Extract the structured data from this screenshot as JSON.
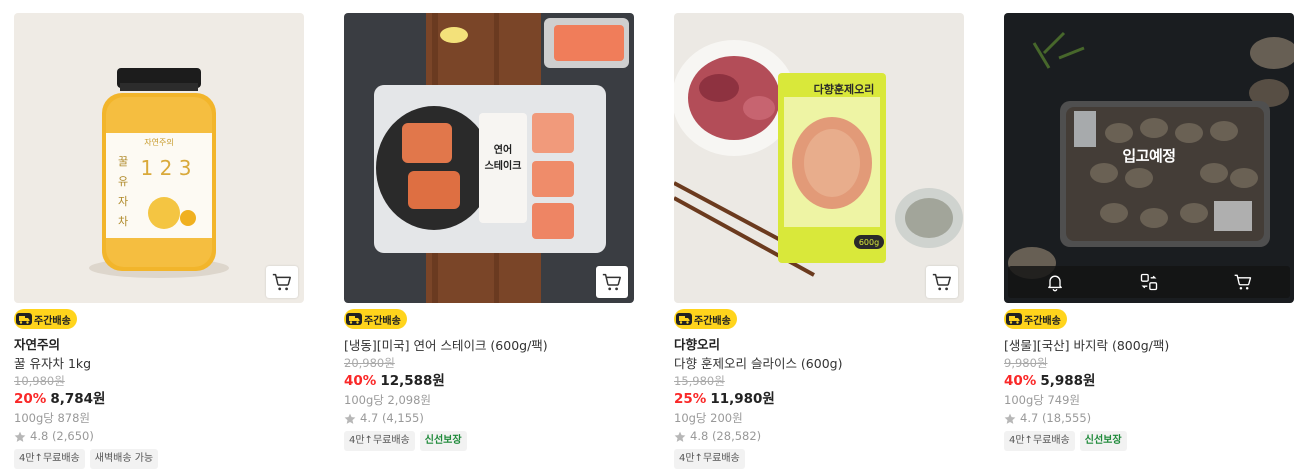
{
  "colors": {
    "badge": "#ffd41c",
    "discount": "#fa2828",
    "fresh_tag": "#1f8a3a",
    "overlay_bar": "#141414"
  },
  "products": [
    {
      "badge": "주간배송",
      "brand": "자연주의",
      "name": "꿀 유자차 1kg",
      "original_price": "10,980원",
      "discount": "20%",
      "price": "8,784원",
      "unit_price": "100g당 878원",
      "rating": "4.8 (2,650)",
      "tags": [
        "4만↑무료배송",
        "새벽배송 가능"
      ],
      "image_icon": "citron-tea-jar",
      "image_text": {
        "label": "자연주의",
        "vertical": "꿀 유자차",
        "numbers": "1 2 3"
      }
    },
    {
      "badge": "주간배송",
      "name": "[냉동][미국] 연어 스테이크 (600g/팩)",
      "original_price": "20,980원",
      "discount": "40%",
      "price": "12,588원",
      "unit_price": "100g당 2,098원",
      "rating": "4.7 (4,155)",
      "tags": [
        "4만↑무료배송",
        "신선보장"
      ],
      "image_icon": "salmon-steak-pack",
      "image_text": {
        "label": "연어\n스테이크"
      }
    },
    {
      "badge": "주간배송",
      "brand": "다향오리",
      "name": "다향 훈제오리 슬라이스 (600g)",
      "original_price": "15,980원",
      "discount": "25%",
      "price": "11,980원",
      "unit_price": "10g당 200원",
      "rating": "4.8 (28,582)",
      "tags": [
        "4만↑무료배송"
      ],
      "image_icon": "smoked-duck-pack",
      "image_text": {
        "label": "다향훈제오리",
        "weight": "600g"
      }
    },
    {
      "badge": "주간배송",
      "name": "[생물][국산] 바지락 (800g/팩)",
      "original_price": "9,980원",
      "discount": "40%",
      "price": "5,988원",
      "unit_price": "100g당 749원",
      "rating": "4.7 (18,555)",
      "tags": [
        "4만↑무료배송",
        "신선보장"
      ],
      "image_icon": "clams-tray",
      "overlay_text": "입고예정"
    }
  ]
}
